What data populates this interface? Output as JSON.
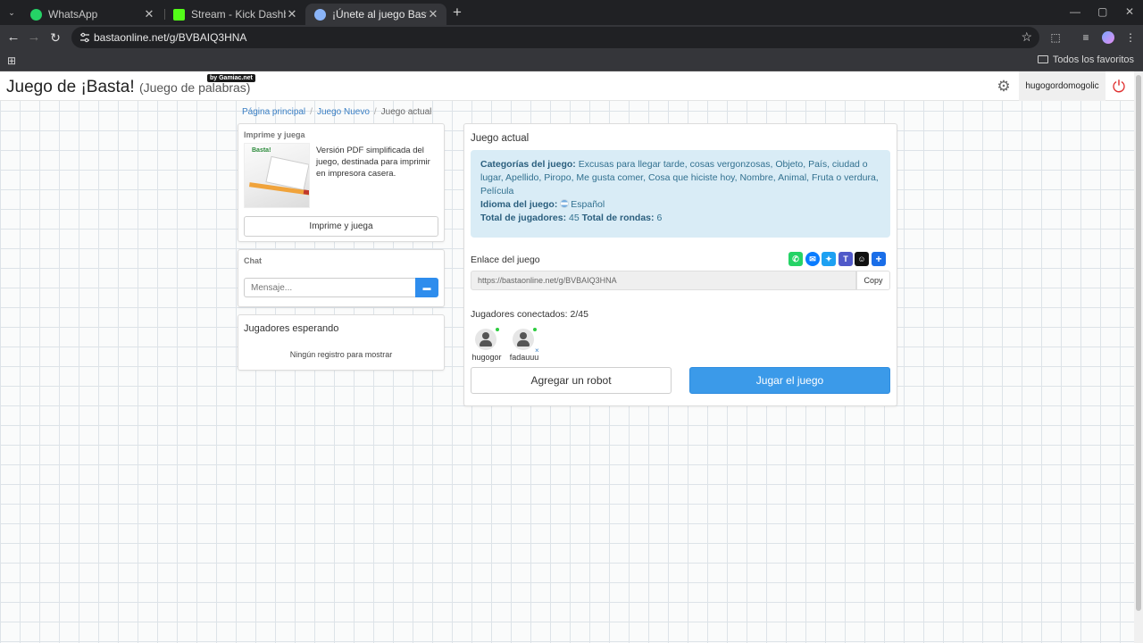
{
  "browser": {
    "tabs": [
      {
        "title": "WhatsApp",
        "icon": "whatsapp-icon",
        "color": "#25d366"
      },
      {
        "title": "Stream - Kick Dashboard",
        "icon": "kick-icon",
        "color": "#53fc18"
      },
      {
        "title": "¡Únete al juego Basta!",
        "icon": "globe-icon",
        "color": "#8ab4f8"
      }
    ],
    "close_glyph": "✕",
    "url": "bastaonline.net/g/BVBAIQ3HNA",
    "bookmarks_all": "Todos los favoritos"
  },
  "header": {
    "title": "Juego de ¡Basta!",
    "subtitle": "(Juego de palabras)",
    "badge": "by Gamiac.net",
    "username": "hugogordomogolic"
  },
  "breadcrumb": [
    "Página principal",
    "Juego Nuevo",
    "Juego actual"
  ],
  "promo": {
    "label": "Imprime y juega",
    "logo_text": "Basta!",
    "text": "Versión PDF simplificada del juego, destinada para imprimir en impresora casera.",
    "button": "Imprime y juega"
  },
  "chat": {
    "label": "Chat",
    "placeholder": "Mensaje..."
  },
  "waiting": {
    "title": "Jugadores esperando",
    "empty": "Ningún registro para mostrar"
  },
  "game": {
    "title": "Juego actual",
    "categories_label": "Categorías del juego:",
    "categories": "Excusas para llegar tarde, cosas vergonzosas, Objeto, País, ciudad o lugar, Apellido, Piropo, Me gusta comer, Cosa que hiciste hoy, Nombre, Animal, Fruta o verdura, Película",
    "language_label": "Idioma del juego:",
    "language": "Español",
    "players_label": "Total de jugadores:",
    "players": "45",
    "rounds_label": "Total de rondas:",
    "rounds": "6",
    "link_label": "Enlace del juego",
    "link": "https://bastaonline.net/g/BVBAIQ3HNA",
    "copy": "Copy",
    "connected_label": "Jugadores conectados: 2/45",
    "players_list": [
      {
        "name": "hugogor"
      },
      {
        "name": "fadauuu",
        "remove": "×"
      }
    ],
    "add_robot": "Agregar un robot",
    "play": "Jugar el juego"
  },
  "share_icons": [
    {
      "name": "whatsapp-share-icon",
      "color": "#25d366",
      "glyph": "✆"
    },
    {
      "name": "messenger-share-icon",
      "color": "#0a7cff",
      "glyph": "✉"
    },
    {
      "name": "twitter-share-icon",
      "color": "#1da1f2",
      "glyph": "✦"
    },
    {
      "name": "teams-share-icon",
      "color": "#5059c9",
      "glyph": "T"
    },
    {
      "name": "snapchat-share-icon",
      "color": "#111111",
      "glyph": "☺"
    },
    {
      "name": "more-share-icon",
      "color": "#1a6ee8",
      "glyph": "+"
    }
  ]
}
